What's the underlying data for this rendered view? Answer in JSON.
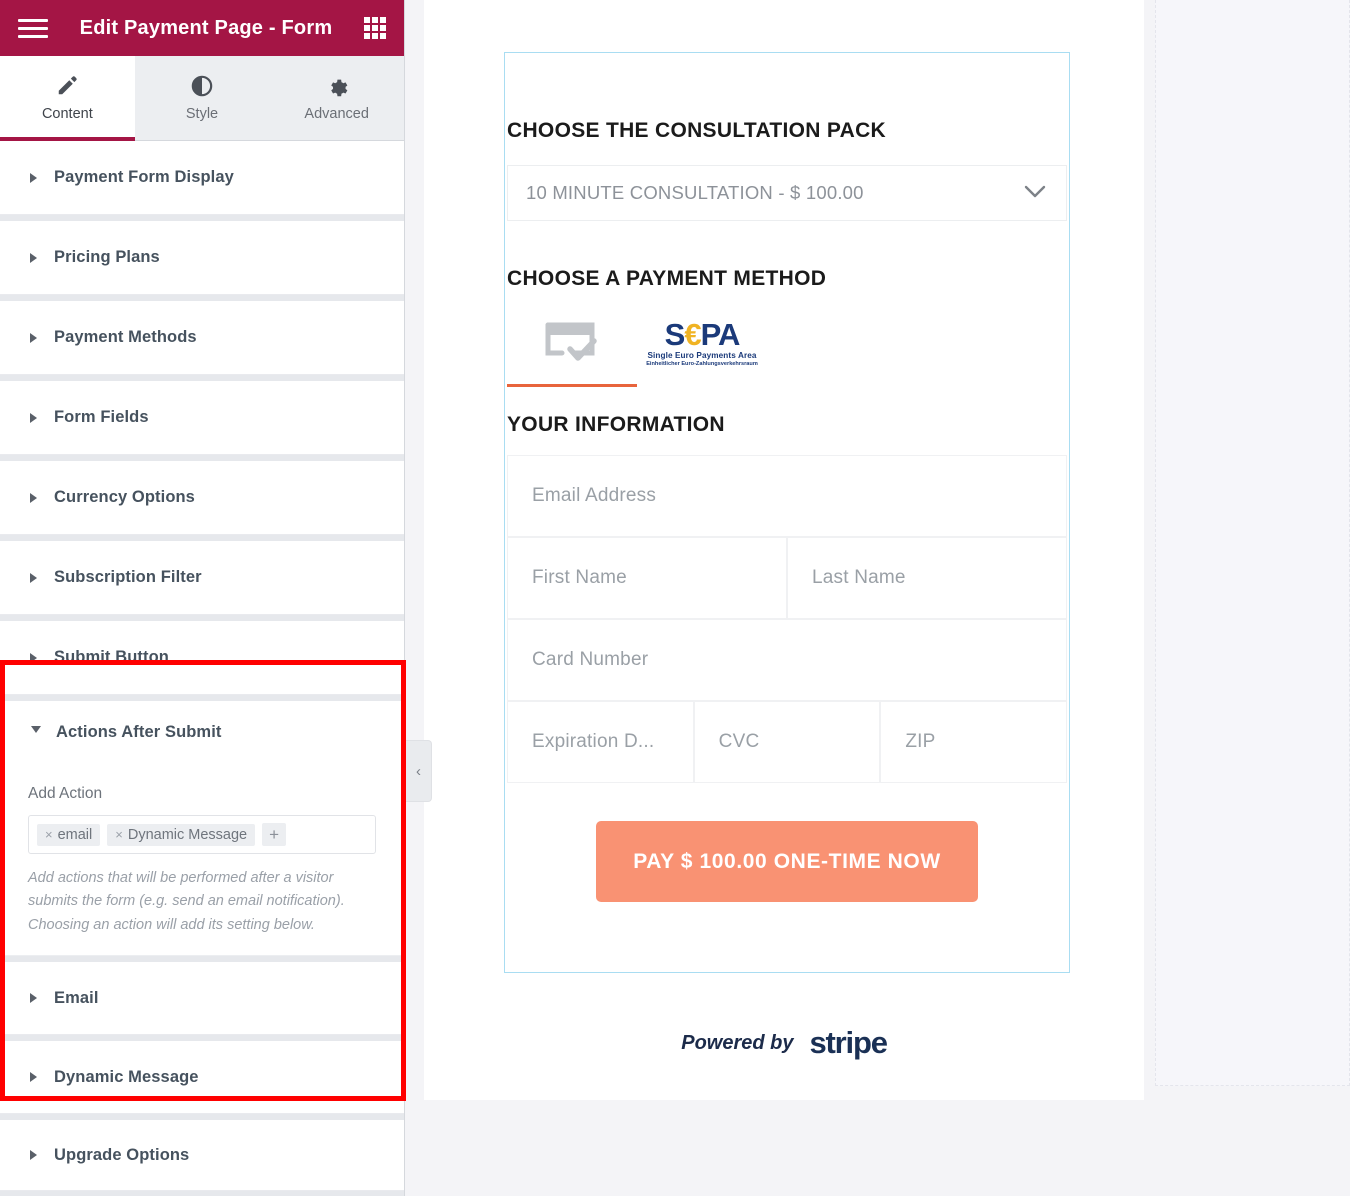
{
  "panel": {
    "title": "Edit Payment Page - Form",
    "menu_icon": "hamburger-icon",
    "apps_icon": "grid-icon",
    "tabs": [
      {
        "label": "Content",
        "icon": "pencil-icon",
        "active": true
      },
      {
        "label": "Style",
        "icon": "contrast-icon",
        "active": false
      },
      {
        "label": "Advanced",
        "icon": "gear-icon",
        "active": false
      }
    ],
    "sections": [
      {
        "label": "Payment Form Display"
      },
      {
        "label": "Pricing Plans"
      },
      {
        "label": "Payment Methods"
      },
      {
        "label": "Form Fields"
      },
      {
        "label": "Currency Options"
      },
      {
        "label": "Subscription Filter"
      },
      {
        "label": "Submit Button"
      }
    ],
    "actions_after_submit": {
      "label": "Actions After Submit",
      "expanded": true,
      "add_action_label": "Add Action",
      "tokens": [
        "email",
        "Dynamic Message"
      ],
      "add_token_glyph": "+",
      "help_text": "Add actions that will be performed after a visitor submits the form (e.g. send an email notification). Choosing an action will add its setting below.",
      "sub_sections": [
        {
          "label": "Email"
        },
        {
          "label": "Dynamic Message"
        }
      ]
    },
    "trailing_sections": [
      {
        "label": "Upgrade Options"
      }
    ],
    "collapse_handle_glyph": "‹",
    "header_color": "#a41545",
    "highlight_color": "#ff0000"
  },
  "preview": {
    "pack_heading": "CHOOSE THE CONSULTATION PACK",
    "pack_select_value": "10 MINUTE CONSULTATION - $ 100.00",
    "pack_select_caret": "⌄",
    "method_heading": "CHOOSE A PAYMENT METHOD",
    "methods": [
      {
        "name": "card-payment-method",
        "label": "",
        "active": true
      },
      {
        "name": "sepa-payment-method",
        "label": "",
        "active": false
      }
    ],
    "sepa": {
      "s": "S",
      "euro": "€",
      "pa": "PA",
      "sub1": "Single Euro Payments Area",
      "sub2": "Einheitlicher Euro-Zahlungsverkehrsraum"
    },
    "info_heading": "YOUR INFORMATION",
    "fields": [
      {
        "name": "email-field",
        "placeholder": "Email Address"
      },
      {
        "name": "first-name-field",
        "placeholder": "First Name"
      },
      {
        "name": "last-name-field",
        "placeholder": "Last Name"
      },
      {
        "name": "card-number-field",
        "placeholder": "Card Number"
      },
      {
        "name": "expiration-field",
        "placeholder": "Expiration D..."
      },
      {
        "name": "cvc-field",
        "placeholder": "CVC"
      },
      {
        "name": "zip-field",
        "placeholder": "ZIP"
      }
    ],
    "pay_button_label": "PAY $ 100.00 ONE-TIME NOW",
    "pay_button_color": "#f99273",
    "powered_by_label": "Powered by",
    "stripe_label": "stripe",
    "outline_color": "#a9ddf2",
    "active_method_underline": "#e8643c"
  }
}
